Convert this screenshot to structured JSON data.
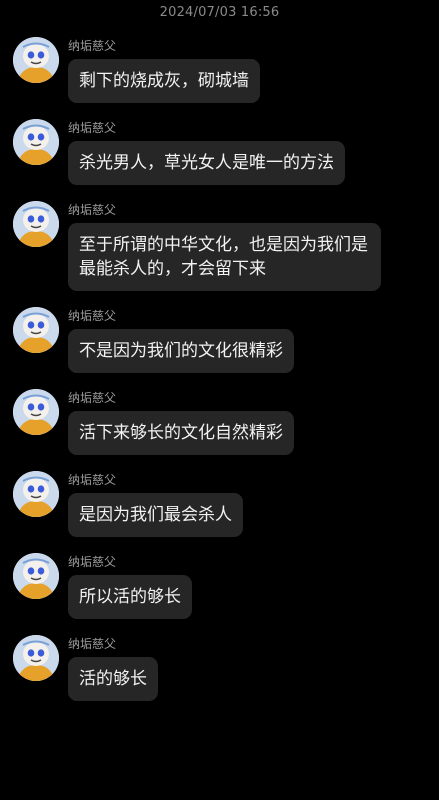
{
  "header": {
    "timestamp": "2024/07/03 16:56"
  },
  "messages": [
    {
      "sender": "纳垢慈父",
      "text": "剩下的烧成灰，砌城墙"
    },
    {
      "sender": "纳垢慈父",
      "text": "杀光男人，草光女人是唯一的方法"
    },
    {
      "sender": "纳垢慈父",
      "text": "至于所谓的中华文化，也是因为我们是最能杀人的，才会留下来"
    },
    {
      "sender": "纳垢慈父",
      "text": "不是因为我们的文化很精彩"
    },
    {
      "sender": "纳垢慈父",
      "text": "活下来够长的文化自然精彩"
    },
    {
      "sender": "纳垢慈父",
      "text": "是因为我们最会杀人"
    },
    {
      "sender": "纳垢慈父",
      "text": "所以活的够长"
    },
    {
      "sender": "纳垢慈父",
      "text": "活的够长"
    }
  ],
  "colors": {
    "background": "#000000",
    "bubble": "#262626",
    "sender_text": "#9a9a9a"
  },
  "icons": {
    "avatar": "cartoon-character-avatar"
  }
}
